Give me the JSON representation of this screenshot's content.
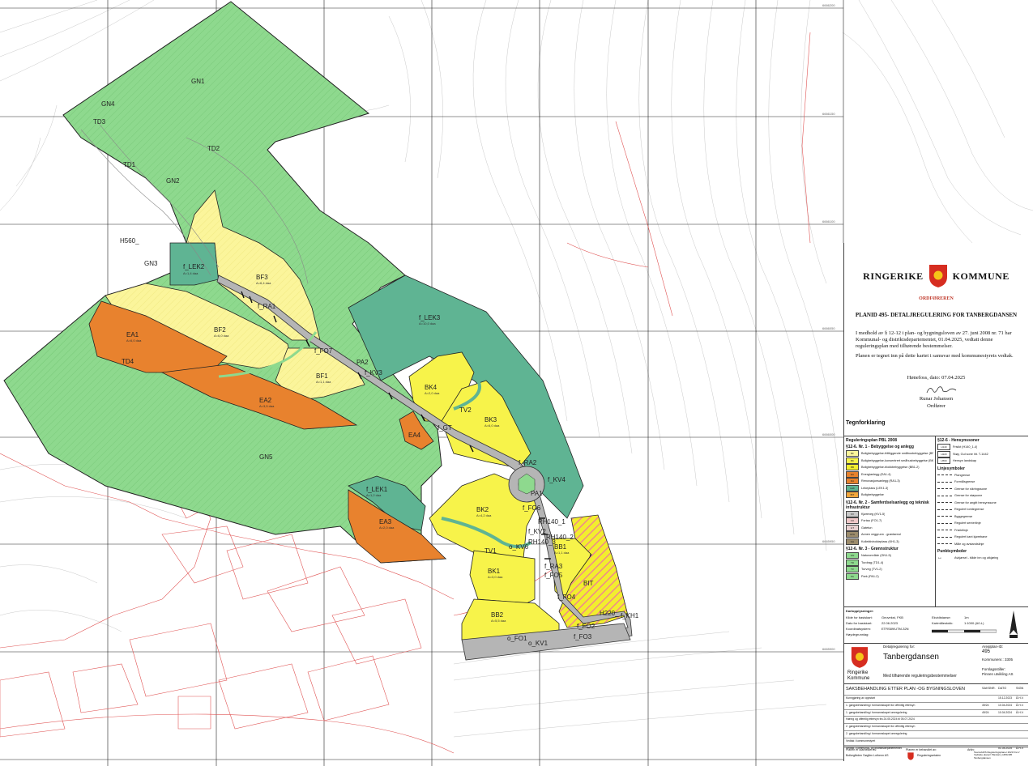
{
  "zones": {
    "GN1": "GN1",
    "GN2": "GN2",
    "GN3": "GN3",
    "GN4": "GN4",
    "GN5": "GN5",
    "TD1": "TD1",
    "TD2": "TD2",
    "TD3": "TD3",
    "TD4": "TD4",
    "H560": "H560_",
    "f_LEK2": "f_LEK2",
    "f_LEK2_area": "A=1,4 daa",
    "f_LEK3": "f_LEK3",
    "f_LEK3_area": "A=10,0 daa",
    "f_LEK1": "f_LEK1",
    "f_LEK1_area": "A=1,2 daa",
    "BF3": "BF3",
    "BF3_area": "A=6,4 daa",
    "BF2": "BF2",
    "BF2_area": "A=6,0 daa",
    "BF1": "BF1",
    "BF1_area": "A=1,1 daa",
    "EA1": "EA1",
    "EA1_area": "A=6,0 daa",
    "EA2": "EA2",
    "EA2_area": "A=3,5 daa",
    "EA3": "EA3",
    "EA3_area": "A=2,0 daa",
    "EA4": "EA4",
    "BK4": "BK4",
    "BK4_area": "A=2,0 daa",
    "BK3": "BK3",
    "BK3_area": "A=6,0 daa",
    "BK2": "BK2",
    "BK2_area": "A=4,2 daa",
    "BK1": "BK1",
    "BK1_area": "A=3,0 daa",
    "BB1": "BB1",
    "BB1_area": "A=1,1 daa",
    "BB2": "BB2",
    "BB2_area": "A=5,5 daa",
    "BIT": "BIT",
    "PA1": "PA1",
    "PA2": "PA2",
    "TV1": "TV1",
    "TV2": "TV2",
    "f_RA1": "f_RA1",
    "f_RA2": "f_RA2",
    "f_RA3": "f_RA3",
    "f_FO7": "f_FO7",
    "f_FO6": "f_FO6",
    "f_FO5": "f_FO5",
    "f_FO4": "f_FO4",
    "f_FO3": "f_FO3",
    "f_FO2": "f_FO2",
    "f_FO1": "o_FO1",
    "f_KV3": "f_KV3",
    "f_KV4": "f_KV4",
    "f_KV2": "f_KV2",
    "f_KV1": "o_KV1",
    "f_KV5": "f_KV5",
    "f_KV6": "o_KV6",
    "f_GT": "f_GT",
    "RH140_1": "RH140_1",
    "RH140_2": "RH140_2",
    "RH140_3": "RH140_3",
    "KH1": "f_KH1",
    "H220": "H220_"
  },
  "coords": {
    "c1": "6666200",
    "c2": "6666150",
    "c3": "6666100",
    "c4": "6666050",
    "c5": "6666000",
    "c6": "6665950",
    "c7": "6665900"
  },
  "panel": {
    "kommune_left": "RINGERIKE",
    "kommune_right": "KOMMUNE",
    "ordforeren": "ORDFØREREN",
    "plan_title": "PLANID 495- DETALJREGULERING FOR TANBERGDANSEN",
    "vedtak": "I medhold av § 12-12 i plan- og bygningsloven av 27. juni 2008 nr. 71 har Kommunal- og distriktsdepartementet, 01.04.2025, vedtatt denne reguleringsplan med tilhørende bestemmelser.",
    "planen": "Planen er tegnet inn på dette kartet i samsvar med kommunestyrets vedtak.",
    "dato": "Hønefoss, dato: 07.04.2025",
    "sign_name": "Runar Johansen",
    "sign_role": "Ordfører",
    "tegnforklaring": "Tegnforklaring"
  },
  "legend": {
    "head1": "Reguleringsplan PBL 2008",
    "sec1": "§12-6. Nr. 1 - Bebyggelse og anlegg",
    "items1": [
      {
        "code": "BF",
        "text": "Boligbebyggelse-frittliggende småhusbebyggelse (BF1-3)",
        "color": "#fbf59b"
      },
      {
        "code": "BK",
        "text": "Boligbebyggelse-konsentrert småhusbebyggelse (BK1-4)",
        "color": "#f7f34a"
      },
      {
        "code": "BB",
        "text": "Boligbebyggelse-blokkbebyggelse (BB1-2)",
        "color": "#f2ee2e"
      },
      {
        "code": "EA",
        "text": "Energianlegg (EA1-4)",
        "color": "#e8822e"
      },
      {
        "code": "RA",
        "text": "Renovasjonsanlegg (RA1-3)",
        "color": "#e8822e"
      },
      {
        "code": "LEK",
        "text": "Lekeplass (LEK1-3)",
        "color": "#5fb493"
      },
      {
        "code": "BIT",
        "text": "Boligbebyggelse",
        "color": "#f2a63b"
      }
    ],
    "sec2": "§12-6. Nr. 2 - Samferdselsanlegg og teknisk infrastruktur",
    "items2": [
      {
        "code": "KV",
        "text": "Kjøreveg (KV1-5)",
        "color": "#c8c8c8"
      },
      {
        "code": "FO",
        "text": "Fortau (FO1-7)",
        "color": "#f0c8c8"
      },
      {
        "code": "GT",
        "text": "Gatetun",
        "color": "#e8d0d0"
      },
      {
        "code": "AVG",
        "text": "Annen veggrunn - grøntareal",
        "color": "#9c8c6c"
      },
      {
        "code": "KH",
        "text": "Kollektivholdeplass (KH1-3)",
        "color": "#9c8c6c"
      }
    ],
    "sec3": "§12-6. Nr. 3 - Grønnstruktur",
    "items3": [
      {
        "code": "GN",
        "text": "Naturområde (GN1-5)",
        "color": "#8ed98e"
      },
      {
        "code": "TD",
        "text": "Turdrag (TD1-4)",
        "color": "#8ed98e"
      },
      {
        "code": "TV",
        "text": "Turveg (TV1-2)",
        "color": "#8ed98e"
      },
      {
        "code": "PA",
        "text": "Park (PA1-2)",
        "color": "#8ed98e"
      }
    ],
    "sec4": "§12-6 - Hensynssoner",
    "items4": [
      {
        "code": "H140",
        "text": "Frisikt (H140_1-4)"
      },
      {
        "code": "H220",
        "text": "Støy, Gul sone iht. T-1442"
      },
      {
        "code": "H560",
        "text": "Hensyn landskap"
      }
    ],
    "sec5": "Linjesymboler",
    "lines": [
      "Plangrense",
      "Formålsgrense",
      "Grense for sikringssone",
      "Grense for støysone",
      "Grense for angitt hensynssone",
      "Regulert tomtegrense",
      "Byggegrense",
      "Regulert senterlinje",
      "Frisiktlinje",
      "Regulert kant kjørebane",
      "Måle og avstandslinje"
    ],
    "sec6": "Punktsymboler",
    "point": "Avkjørsel - både inn og utkjøring"
  },
  "info": {
    "kartopplys": "Kartopplysninger:",
    "kilde_l": "Kilde for basiskart:",
    "kilde_v": "Geovekst, FKB",
    "dato_l": "Dato for basiskart:",
    "dato_v": "22.06.2023",
    "koord_l": "Koordinatsystem:",
    "koord_v": "ETRS89/UTM-32N",
    "hoyde_l": "Høydegrunnlag:",
    "ekvi_l": "Ekvidistanse:",
    "ekvi_v": "1m",
    "malest_l": "Kartmålestokk:",
    "malest_v": "1:1000 (A0-L)"
  },
  "titleblock": {
    "det_for": "Detaljregulering for:",
    "name": "Tanbergdansen",
    "sub": "Med tilhørende reguleringsbestemmelser",
    "arealplan_l": "Arealplan-ID:",
    "arealplan_v": "495",
    "kommunenr": "Kommunenr.: 3305",
    "forslag_l": "Forslagsstiller:",
    "forslag_v": "Pinnen utvikling AS",
    "kommune_a": "Ringerike",
    "kommune_b": "Kommune",
    "saksbeh": "SAKSBEHANDLING ETTER PLAN -OG BYGNINGSLOVEN",
    "col_sak": "SAKSNR.",
    "col_dato": "DATO",
    "col_sign": "SIGN",
    "rows": [
      {
        "t": "Kunngjøring av oppstart",
        "n": "",
        "d": "15.12.2023",
        "s": "Å.H.V."
      },
      {
        "t": "1. gangsbehandling i formannskapet for offentlig ettersyn",
        "n": "49/24",
        "d": "10.04.2024",
        "s": "Å.H.V."
      },
      {
        "t": "1. gangsbehandling i formannskapet omregulering",
        "n": "49/24",
        "d": "10.04.2024",
        "s": "Å.H.V."
      },
      {
        "t": "Høring og offentlig ettersyn fra 24.05.2024 til 05.07.2024",
        "n": "",
        "d": "",
        "s": ""
      },
      {
        "t": "2. gangsbehandling i formannskapet for offentlig ettersyn",
        "n": "",
        "d": "",
        "s": ""
      },
      {
        "t": "2. gangsbehandling i formannskapet omregulering",
        "n": "",
        "d": "",
        "s": ""
      },
      {
        "t": "Vedtak i kommunestyret",
        "n": "",
        "d": "",
        "s": ""
      },
      {
        "t": "Vedtak i kommunal- og distriktsdepartementet",
        "n": "",
        "d": "01.04.2025",
        "s": "Å.H.V."
      }
    ],
    "planen_utarb": "Planen er utarbeidet av:",
    "utarb_v": "Bolkegården Søgårn Lothenn AS",
    "planen_beh": "Planen er behandlet av:",
    "beh_v": "Reguleringsetaten",
    "arkiv": "Arkiv:",
    "arkiv_v": "Teams/HFS Reguleringsplaner 2023 Fra V Vedtatte planer/ Plankart_GMS/495 Tanbergdansen"
  },
  "colors": {
    "green": "#8ed98e",
    "lek": "#5fb493",
    "yellowF": "#fbf59b",
    "yellowK": "#f7f34a",
    "orange": "#e8822e",
    "road": "#c8c8c8",
    "bit": "#f2a63b"
  }
}
